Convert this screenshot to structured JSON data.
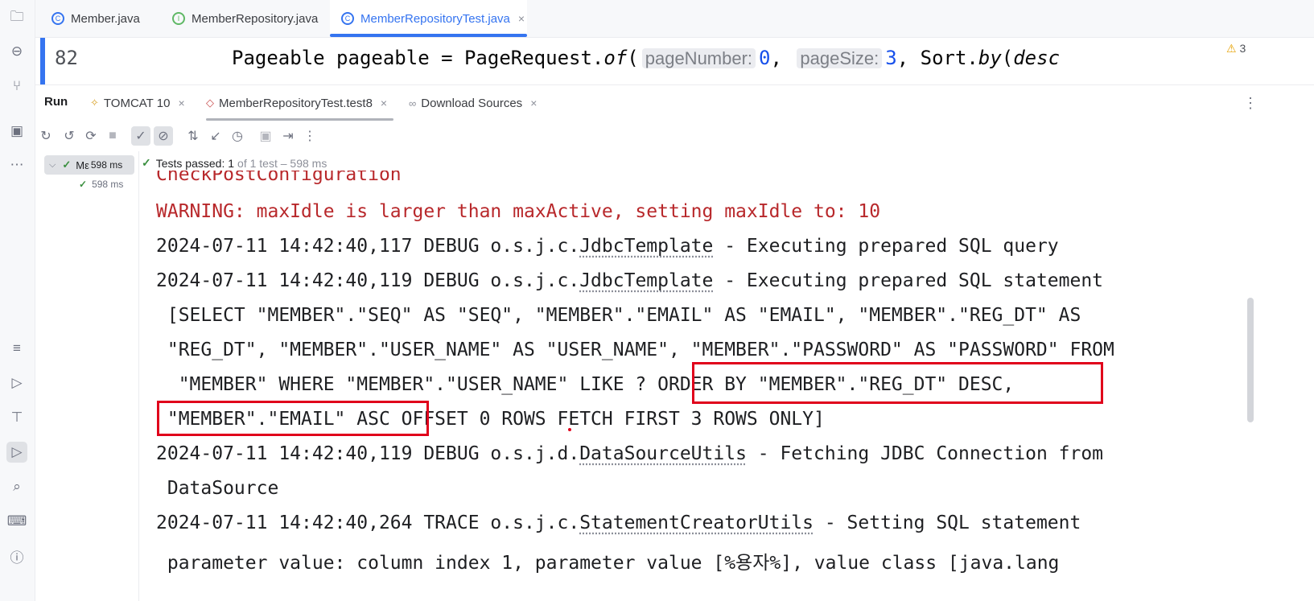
{
  "editor_tabs": [
    {
      "label": "Member.java",
      "icon": "class-icon"
    },
    {
      "label": "MemberRepository.java",
      "icon": "interface-icon"
    },
    {
      "label": "MemberRepositoryTest.java",
      "icon": "test-class-icon",
      "close": "×"
    }
  ],
  "editor": {
    "line_number": "82",
    "code": {
      "a": "Pageable pageable = PageRequest.",
      "of": "of",
      "paren": "(",
      "hint1": "pageNumber:",
      "v1": "0",
      "comma1": ",",
      "hint2": "pageSize:",
      "v2": "3",
      "b": ", Sort.",
      "by": "by",
      "c": "(",
      "desc": "desc"
    },
    "warning_count": "3"
  },
  "run_window": {
    "label": "Run",
    "tabs": [
      {
        "label": "TOMCAT 10",
        "close": "×"
      },
      {
        "label": "MemberRepositoryTest.test8",
        "close": "×"
      },
      {
        "label": "Download Sources",
        "close": "×"
      }
    ]
  },
  "tree": {
    "root_label": "Mε",
    "root_time": "598 ms",
    "child_time": "598 ms"
  },
  "status": {
    "prefix": "Tests passed:",
    "count": "1",
    "suffix": "of 1 test – 598 ms"
  },
  "console": {
    "line0": "CheckPostConfiguration",
    "line1": "WARNING: maxIdle is larger than maxActive, setting maxIdle to: 10",
    "line2a": "2024-07-11 14:42:40,117 DEBUG o.s.j.c.",
    "line2b": "JdbcTemplate",
    "line2c": " - Executing prepared SQL query",
    "line3a": "2024-07-11 14:42:40,119 DEBUG o.s.j.c.",
    "line3b": "JdbcTemplate",
    "line3c": " - Executing prepared SQL statement",
    "line4": " [SELECT \"MEMBER\".\"SEQ\" AS \"SEQ\", \"MEMBER\".\"EMAIL\" AS \"EMAIL\", \"MEMBER\".\"REG_DT\" AS",
    "line5": " \"REG_DT\", \"MEMBER\".\"USER_NAME\" AS \"USER_NAME\", \"MEMBER\".\"PASSWORD\" AS \"PASSWORD\" FROM",
    "line6": "  \"MEMBER\" WHERE \"MEMBER\".\"USER_NAME\" LIKE ? ORDER BY \"MEMBER\".\"REG_DT\" DESC,",
    "line7": " \"MEMBER\".\"EMAIL\" ASC OFFSET 0 ROWS FETCH FIRST 3 ROWS ONLY]",
    "line8a": "2024-07-11 14:42:40,119 DEBUG o.s.j.d.",
    "line8b": "DataSourceUtils",
    "line8c": " - Fetching JDBC Connection from",
    "line9": " DataSource",
    "line10a": "2024-07-11 14:42:40,264 TRACE o.s.j.c.",
    "line10b": "StatementCreatorUtils",
    "line10c": " - Setting SQL statement",
    "line11": " parameter value: column index 1, parameter value [%용자%], value class [java.lang"
  }
}
